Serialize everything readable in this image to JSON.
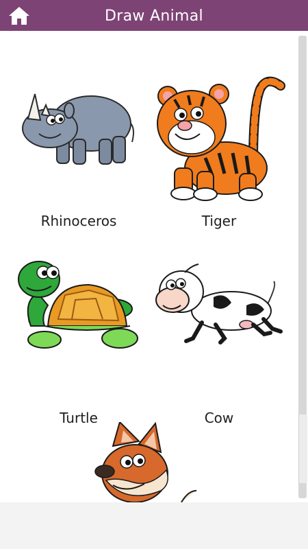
{
  "header": {
    "title": "Draw Animal",
    "home_icon": "home-icon",
    "background": "#7e4375"
  },
  "animals": [
    {
      "name": "Rhinoceros",
      "color": "#8a98ad"
    },
    {
      "name": "Tiger",
      "color": "#f07c1e"
    },
    {
      "name": "Turtle",
      "color": "#2ea83a"
    },
    {
      "name": "Cow",
      "color": "#ffffff"
    },
    {
      "name": "",
      "color": "#d7692c"
    }
  ]
}
